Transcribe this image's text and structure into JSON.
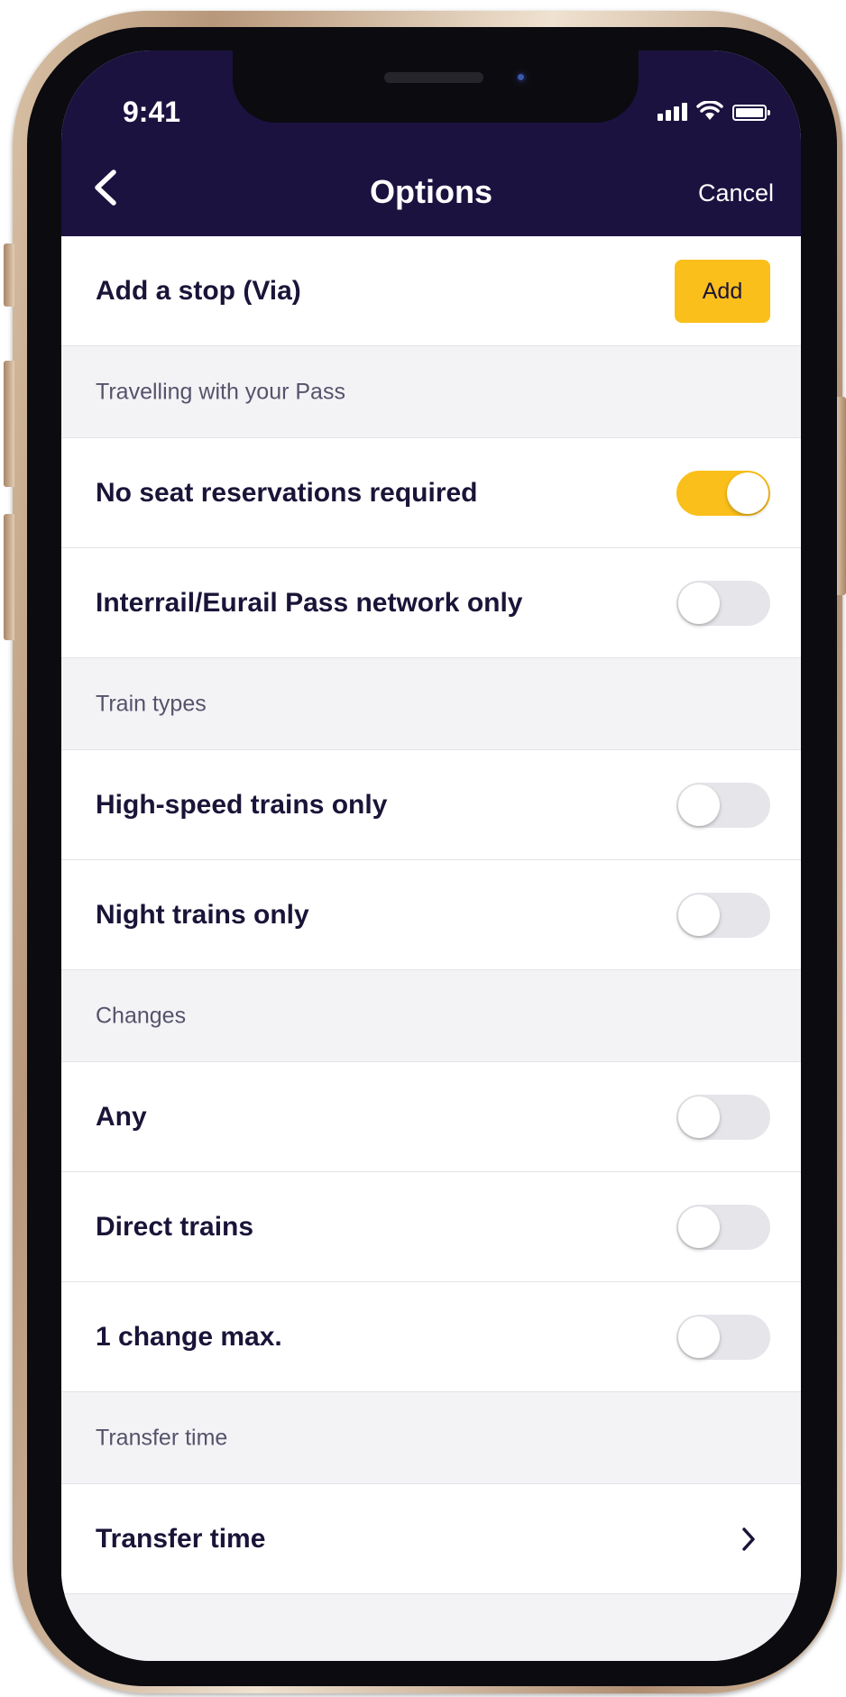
{
  "status_bar": {
    "time": "9:41"
  },
  "header": {
    "title": "Options",
    "cancel_label": "Cancel"
  },
  "via": {
    "label": "Add a stop (Via)",
    "button_label": "Add"
  },
  "sections": {
    "pass": {
      "title": "Travelling with your Pass",
      "items": [
        {
          "label": "No seat reservations required",
          "enabled": true
        },
        {
          "label": "Interrail/Eurail Pass network only",
          "enabled": false
        }
      ]
    },
    "train_types": {
      "title": "Train types",
      "items": [
        {
          "label": "High-speed trains only",
          "enabled": false
        },
        {
          "label": "Night trains only",
          "enabled": false
        }
      ]
    },
    "changes": {
      "title": "Changes",
      "items": [
        {
          "label": "Any",
          "enabled": false
        },
        {
          "label": "Direct trains",
          "enabled": false
        },
        {
          "label": "1 change max.",
          "enabled": false
        }
      ]
    },
    "transfer": {
      "title": "Transfer time",
      "item_label": "Transfer time"
    }
  },
  "colors": {
    "header_bg": "#1b1240",
    "accent_yellow": "#fbbf1b",
    "text_dark": "#1b1438",
    "section_bg": "#f3f3f6",
    "toggle_off": "#e5e5ea"
  },
  "icons": {
    "back": "chevron-left-icon",
    "row_arrow": "chevron-right-icon",
    "signal": "cellular-signal-icon",
    "wifi": "wifi-icon",
    "battery": "battery-icon"
  }
}
